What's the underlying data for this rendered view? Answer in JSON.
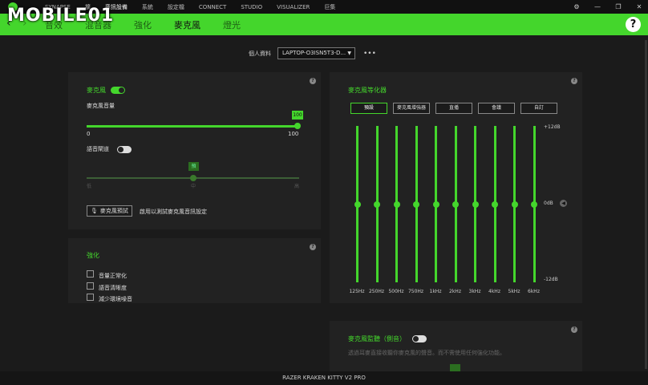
{
  "watermark": "MOBILE01",
  "topnav": [
    "SYNAPSE",
    "擴",
    "音訊設備",
    "系統",
    "設定檔",
    "CONNECT",
    "STUDIO",
    "VISUALIZER",
    "巨集"
  ],
  "window_controls": {
    "settings": "⚙",
    "minimize": "—",
    "restore": "❐",
    "close": "✕"
  },
  "tabs": [
    "音效",
    "混音器",
    "強化",
    "麥克風",
    "燈光"
  ],
  "active_tab": "麥克風",
  "help": "?",
  "profile": {
    "label": "個人資料",
    "value": "LAPTOP-O3ISN5T3-D...",
    "more": "•••"
  },
  "mic_panel": {
    "title": "麥克風",
    "volume_label": "麥克風音量",
    "volume_value": "100",
    "min_label": "0",
    "max_label": "100",
    "volume_fraction": 1.0,
    "gate_label": "語音閘道",
    "gate_badge": "預",
    "gate_low": "低",
    "gate_mid": "中",
    "gate_high": "高",
    "preview_button": "麥克風預試",
    "preview_hint": "啟用以測試麥克風音訊設定"
  },
  "enhance_panel": {
    "title": "強化",
    "items": [
      "音量正常化",
      "語音清晰度",
      "減少環境噪音"
    ]
  },
  "eq_panel": {
    "title": "麥克風等化器",
    "presets": [
      "預設",
      "麥克風增強器",
      "直播",
      "會議",
      "自訂"
    ],
    "active_preset": "預設",
    "top_label": "+12dB",
    "mid_label": "0dB",
    "bottom_label": "-12dB",
    "bands": [
      "125Hz",
      "250Hz",
      "500Hz",
      "750Hz",
      "1kHz",
      "2kHz",
      "3kHz",
      "4kHz",
      "5kHz",
      "6kHz"
    ],
    "band_gains_db": [
      0,
      0,
      0,
      0,
      0,
      0,
      0,
      0,
      0,
      0
    ]
  },
  "monitor_panel": {
    "title": "麥克風監聽（側音）",
    "description": "透過耳麥直接收聽你麥克風的聲音。而不需使用任何強化功能。"
  },
  "footer": "RAZER KRAKEN KITTY V2 PRO",
  "colors": {
    "accent": "#44d62c",
    "background": "#1b1b1b",
    "panel": "#222222"
  }
}
